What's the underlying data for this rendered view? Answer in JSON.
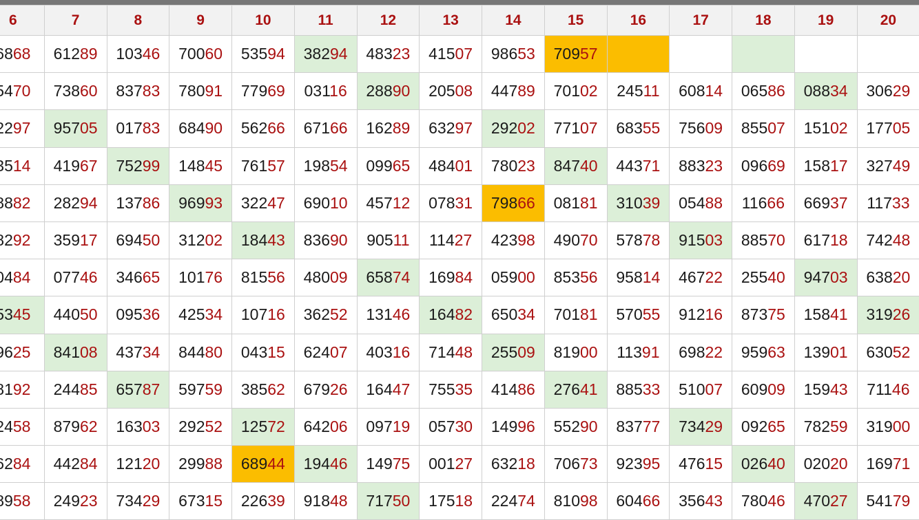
{
  "headers": [
    "6",
    "7",
    "8",
    "9",
    "10",
    "11",
    "12",
    "13",
    "14",
    "15",
    "16",
    "17",
    "18",
    "19",
    "20"
  ],
  "highlight_colors": {
    "green": "#dcefd8",
    "orange": "#fbbd00"
  },
  "rows": [
    [
      [
        "6868",
        ""
      ],
      [
        "61289",
        ""
      ],
      [
        "10346",
        ""
      ],
      [
        "70060",
        ""
      ],
      [
        "53594",
        ""
      ],
      [
        "38294",
        "g"
      ],
      [
        "48323",
        ""
      ],
      [
        "41507",
        ""
      ],
      [
        "98653",
        ""
      ],
      [
        "70957",
        "o"
      ],
      [
        "",
        "o"
      ],
      [
        "",
        ""
      ],
      [
        "",
        "g"
      ],
      [
        "",
        ""
      ],
      [
        "",
        ""
      ]
    ],
    [
      [
        "5470",
        ""
      ],
      [
        "73860",
        ""
      ],
      [
        "83783",
        ""
      ],
      [
        "78091",
        ""
      ],
      [
        "77969",
        ""
      ],
      [
        "03116",
        ""
      ],
      [
        "28890",
        "g"
      ],
      [
        "20508",
        ""
      ],
      [
        "44789",
        ""
      ],
      [
        "70102",
        ""
      ],
      [
        "24511",
        ""
      ],
      [
        "60814",
        ""
      ],
      [
        "06586",
        ""
      ],
      [
        "08834",
        "g"
      ],
      [
        "30629",
        ""
      ]
    ],
    [
      [
        "2297",
        ""
      ],
      [
        "95705",
        "g"
      ],
      [
        "01783",
        ""
      ],
      [
        "68490",
        ""
      ],
      [
        "56266",
        ""
      ],
      [
        "67166",
        ""
      ],
      [
        "16289",
        ""
      ],
      [
        "63297",
        ""
      ],
      [
        "29202",
        "g"
      ],
      [
        "77107",
        ""
      ],
      [
        "68355",
        ""
      ],
      [
        "75609",
        ""
      ],
      [
        "85507",
        ""
      ],
      [
        "15102",
        ""
      ],
      [
        "17705",
        ""
      ]
    ],
    [
      [
        "3514",
        ""
      ],
      [
        "41967",
        ""
      ],
      [
        "75299",
        "g"
      ],
      [
        "14845",
        ""
      ],
      [
        "76157",
        ""
      ],
      [
        "19854",
        ""
      ],
      [
        "09965",
        ""
      ],
      [
        "48401",
        ""
      ],
      [
        "78023",
        ""
      ],
      [
        "84740",
        "g"
      ],
      [
        "44371",
        ""
      ],
      [
        "88323",
        ""
      ],
      [
        "09669",
        ""
      ],
      [
        "15817",
        ""
      ],
      [
        "32749",
        ""
      ]
    ],
    [
      [
        "8882",
        ""
      ],
      [
        "28294",
        ""
      ],
      [
        "13786",
        ""
      ],
      [
        "96993",
        "g"
      ],
      [
        "32247",
        ""
      ],
      [
        "69010",
        ""
      ],
      [
        "45712",
        ""
      ],
      [
        "07831",
        ""
      ],
      [
        "79866",
        "o"
      ],
      [
        "08181",
        ""
      ],
      [
        "31039",
        "g"
      ],
      [
        "05488",
        ""
      ],
      [
        "11666",
        ""
      ],
      [
        "66937",
        ""
      ],
      [
        "11733",
        ""
      ]
    ],
    [
      [
        "8292",
        ""
      ],
      [
        "35917",
        ""
      ],
      [
        "69450",
        ""
      ],
      [
        "31202",
        ""
      ],
      [
        "18443",
        "g"
      ],
      [
        "83690",
        ""
      ],
      [
        "90511",
        ""
      ],
      [
        "11427",
        ""
      ],
      [
        "42398",
        ""
      ],
      [
        "49070",
        ""
      ],
      [
        "57878",
        ""
      ],
      [
        "91503",
        "g"
      ],
      [
        "88570",
        ""
      ],
      [
        "61718",
        ""
      ],
      [
        "74248",
        ""
      ]
    ],
    [
      [
        "0484",
        ""
      ],
      [
        "07746",
        ""
      ],
      [
        "34665",
        ""
      ],
      [
        "10176",
        ""
      ],
      [
        "81556",
        ""
      ],
      [
        "48009",
        ""
      ],
      [
        "65874",
        "g"
      ],
      [
        "16984",
        ""
      ],
      [
        "05900",
        ""
      ],
      [
        "85356",
        ""
      ],
      [
        "95814",
        ""
      ],
      [
        "46722",
        ""
      ],
      [
        "25540",
        ""
      ],
      [
        "94703",
        "g"
      ],
      [
        "63820",
        ""
      ]
    ],
    [
      [
        "5345",
        "g"
      ],
      [
        "44050",
        ""
      ],
      [
        "09536",
        ""
      ],
      [
        "42534",
        ""
      ],
      [
        "10716",
        ""
      ],
      [
        "36252",
        ""
      ],
      [
        "13146",
        ""
      ],
      [
        "16482",
        "g"
      ],
      [
        "65034",
        ""
      ],
      [
        "70181",
        ""
      ],
      [
        "57055",
        ""
      ],
      [
        "91216",
        ""
      ],
      [
        "87375",
        ""
      ],
      [
        "15841",
        ""
      ],
      [
        "31926",
        "g"
      ]
    ],
    [
      [
        "9625",
        ""
      ],
      [
        "84108",
        "g"
      ],
      [
        "43734",
        ""
      ],
      [
        "84480",
        ""
      ],
      [
        "04315",
        ""
      ],
      [
        "62407",
        ""
      ],
      [
        "40316",
        ""
      ],
      [
        "71448",
        ""
      ],
      [
        "25509",
        "g"
      ],
      [
        "81900",
        ""
      ],
      [
        "11391",
        ""
      ],
      [
        "69822",
        ""
      ],
      [
        "95963",
        ""
      ],
      [
        "13901",
        ""
      ],
      [
        "63052",
        ""
      ]
    ],
    [
      [
        "8192",
        ""
      ],
      [
        "24485",
        ""
      ],
      [
        "65787",
        "g"
      ],
      [
        "59759",
        ""
      ],
      [
        "38562",
        ""
      ],
      [
        "67926",
        ""
      ],
      [
        "16447",
        ""
      ],
      [
        "75535",
        ""
      ],
      [
        "41486",
        ""
      ],
      [
        "27641",
        "g"
      ],
      [
        "88533",
        ""
      ],
      [
        "51007",
        ""
      ],
      [
        "60909",
        ""
      ],
      [
        "15943",
        ""
      ],
      [
        "71146",
        ""
      ]
    ],
    [
      [
        "2458",
        ""
      ],
      [
        "87962",
        ""
      ],
      [
        "16303",
        ""
      ],
      [
        "29252",
        ""
      ],
      [
        "12572",
        "g"
      ],
      [
        "64206",
        ""
      ],
      [
        "09719",
        ""
      ],
      [
        "05730",
        ""
      ],
      [
        "14996",
        ""
      ],
      [
        "55290",
        ""
      ],
      [
        "83777",
        ""
      ],
      [
        "73429",
        "g"
      ],
      [
        "09265",
        ""
      ],
      [
        "78259",
        ""
      ],
      [
        "31900",
        ""
      ]
    ],
    [
      [
        "6284",
        ""
      ],
      [
        "44284",
        ""
      ],
      [
        "12120",
        ""
      ],
      [
        "29988",
        ""
      ],
      [
        "68944",
        "o"
      ],
      [
        "19446",
        "g"
      ],
      [
        "14975",
        ""
      ],
      [
        "00127",
        ""
      ],
      [
        "63218",
        ""
      ],
      [
        "70673",
        ""
      ],
      [
        "92395",
        ""
      ],
      [
        "47615",
        ""
      ],
      [
        "02640",
        "g"
      ],
      [
        "02020",
        ""
      ],
      [
        "16971",
        ""
      ]
    ],
    [
      [
        "8958",
        ""
      ],
      [
        "24923",
        ""
      ],
      [
        "73429",
        ""
      ],
      [
        "67315",
        ""
      ],
      [
        "22639",
        ""
      ],
      [
        "91848",
        ""
      ],
      [
        "71750",
        "g"
      ],
      [
        "17518",
        ""
      ],
      [
        "22474",
        ""
      ],
      [
        "81098",
        ""
      ],
      [
        "60466",
        ""
      ],
      [
        "35643",
        ""
      ],
      [
        "78046",
        ""
      ],
      [
        "47027",
        "g"
      ],
      [
        "54179",
        ""
      ]
    ]
  ]
}
